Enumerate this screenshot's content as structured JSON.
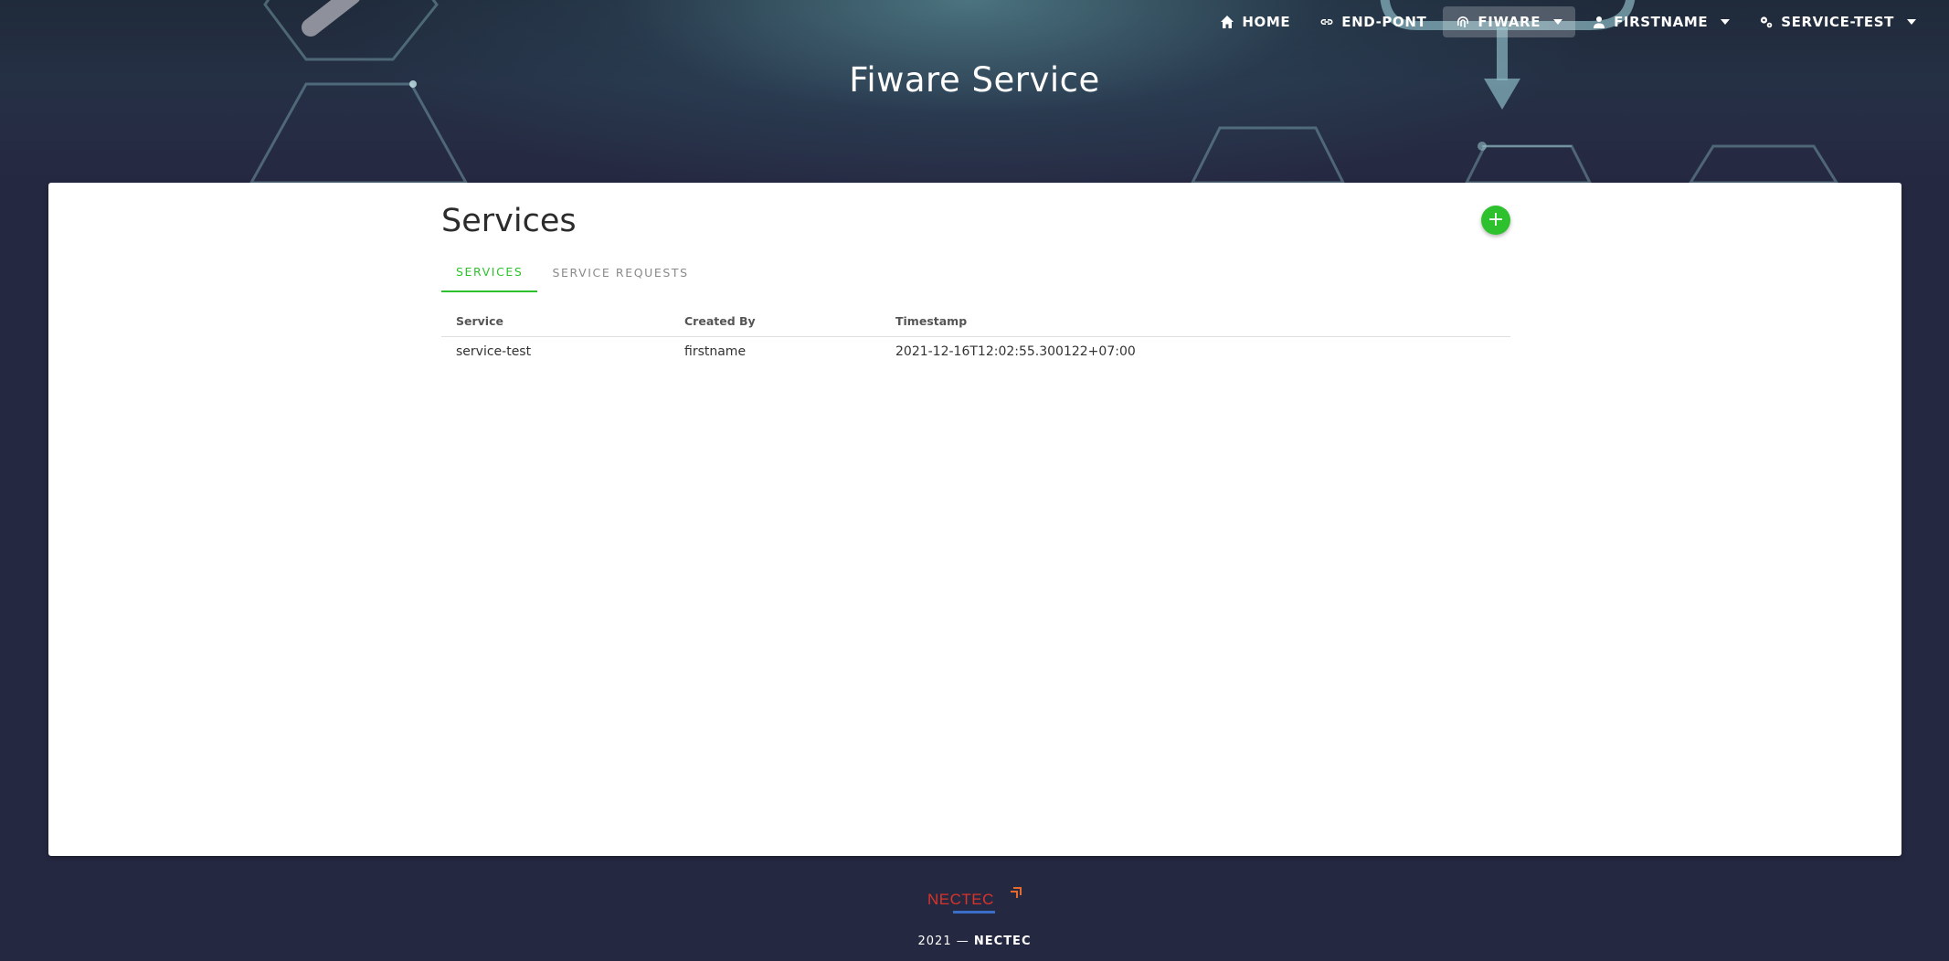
{
  "page": {
    "title": "Fiware Service"
  },
  "nav": {
    "items": [
      {
        "label": "HOME",
        "icon": "home-icon"
      },
      {
        "label": "END-PONT",
        "icon": "link-icon"
      },
      {
        "label": "FIWARE",
        "icon": "fingerprint-icon",
        "active": true,
        "dropdown": true
      },
      {
        "label": "FIRSTNAME",
        "icon": "user-icon",
        "dropdown": true
      },
      {
        "label": "SERVICE-TEST",
        "icon": "gears-icon",
        "dropdown": true
      }
    ]
  },
  "main": {
    "section_title": "Services",
    "add_button": {
      "icon": "plus-icon",
      "label": "+"
    },
    "tabs": [
      {
        "label": "SERVICES",
        "active": true
      },
      {
        "label": "SERVICE REQUESTS",
        "active": false
      }
    ],
    "table": {
      "columns": [
        "Service",
        "Created By",
        "Timestamp"
      ],
      "rows": [
        {
          "service": "service-test",
          "created_by": "firstname",
          "timestamp": "2021-12-16T12:02:55.300122+07:00"
        }
      ]
    }
  },
  "footer": {
    "logo_text": "NECTEC",
    "year": "2021",
    "separator": "—",
    "org": "NECTEC"
  },
  "colors": {
    "accent": "#2ec12e",
    "background": "#252841",
    "card": "#ffffff"
  }
}
